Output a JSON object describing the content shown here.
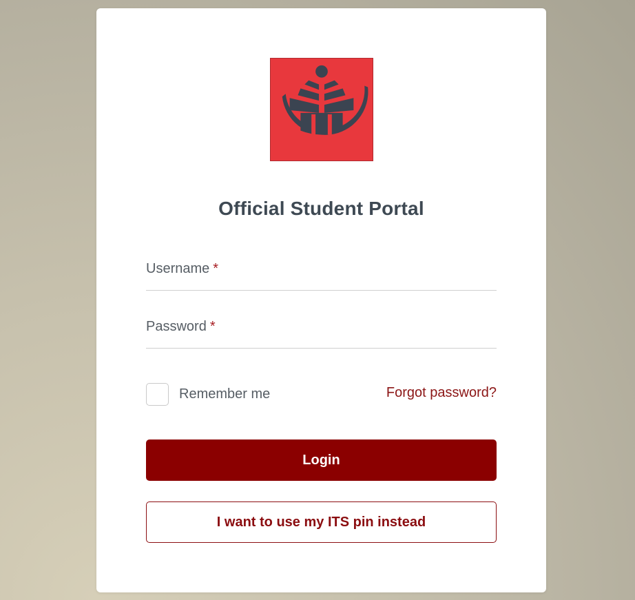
{
  "login": {
    "logo_icon": "university-crest-icon",
    "title": "Official Student Portal",
    "username": {
      "label": "Username",
      "required_mark": "*",
      "value": ""
    },
    "password": {
      "label": "Password",
      "required_mark": "*",
      "value": ""
    },
    "remember_me": {
      "label": "Remember me",
      "checked": false
    },
    "forgot_password_link": "Forgot password?",
    "login_button": "Login",
    "pin_button": "I want to use my ITS pin instead"
  },
  "colors": {
    "brand": "#8b0000",
    "logo_background": "#e8383d",
    "logo_foreground": "#3b4451",
    "title_text": "#3e4953"
  }
}
